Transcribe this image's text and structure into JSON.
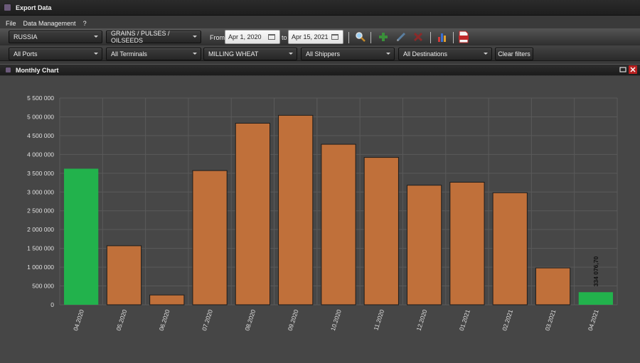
{
  "window": {
    "title": "Export Data"
  },
  "menu": {
    "items": [
      "File",
      "Data Management",
      "?"
    ]
  },
  "filters": {
    "country": "RUSSIA",
    "product_group": "GRAINS / PULSES / OILSEEDS",
    "from_label": "From",
    "from_date": "Apr 1, 2020",
    "to_label": "to",
    "to_date": "Apr 15, 2021",
    "ports": "All Ports",
    "terminals": "All Terminals",
    "commodity": "MILLING WHEAT",
    "shippers": "All Shippers",
    "destinations": "All Destinations",
    "clear_label": "Clear filters"
  },
  "toolbar_icons": [
    "search-icon",
    "add-icon",
    "edit-icon",
    "delete-icon",
    "bar-chart-icon",
    "export-xls-icon"
  ],
  "panel": {
    "title": "Monthly Chart"
  },
  "colors": {
    "bar_default": "#c0703a",
    "bar_highlight": "#22b24c",
    "grid": "#5a5a5a",
    "chart_bg": "#464646"
  },
  "chart_data": {
    "type": "bar",
    "categories": [
      "04.2020",
      "05.2020",
      "06.2020",
      "07.2020",
      "08.2020",
      "09.2020",
      "10.2020",
      "11.2020",
      "12.2020",
      "01.2021",
      "02.2021",
      "03.2021",
      "04.2021"
    ],
    "values": [
      3620000,
      1570000,
      260000,
      3570000,
      4830000,
      5040000,
      4270000,
      3920000,
      3180000,
      3260000,
      2980000,
      980000,
      334076.7
    ],
    "highlight": [
      true,
      false,
      false,
      false,
      false,
      false,
      false,
      false,
      false,
      false,
      false,
      false,
      true
    ],
    "ylim": [
      0,
      5500000
    ],
    "yticks": [
      "0",
      "500 000",
      "1 000 000",
      "1 500 000",
      "2 000 000",
      "2 500 000",
      "3 000 000",
      "3 500 000",
      "4 000 000",
      "4 500 000",
      "5 000 000",
      "5 500 000"
    ],
    "data_label": "334 076,70",
    "title": "",
    "xlabel": "",
    "ylabel": "",
    "grid": true
  }
}
